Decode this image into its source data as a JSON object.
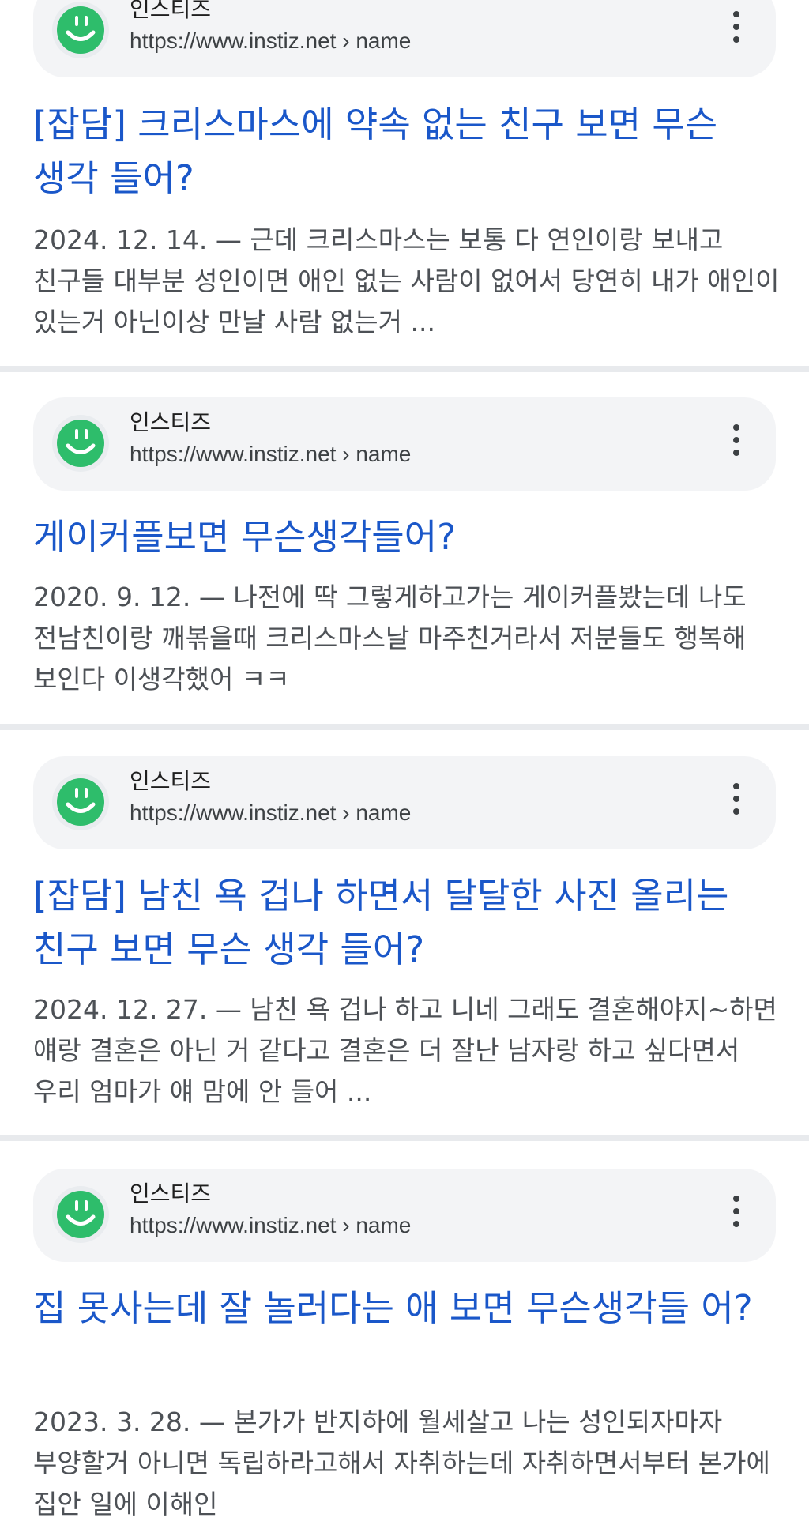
{
  "results": [
    {
      "site_name": "인스티즈",
      "url": "https://www.instiz.net › name",
      "title": "[잡담] 크리스마스에 약속 없는 친구 보면 무슨 생각 들어?",
      "date": "2024. 12. 14.",
      "snippet": "— 근데 크리스마스는 보통 다 연인이랑 보내고 친구들 대부분 성인이면 애인 없는 사람이 없어서 당연히 내가 애인이 있는거 아닌이상 만날 사람 없는거 ..."
    },
    {
      "site_name": "인스티즈",
      "url": "https://www.instiz.net › name",
      "title": "게이커플보면 무슨생각들어?",
      "date": "2020. 9. 12.",
      "snippet": "— 나전에 딱 그렇게하고가는 게이커플봤는데 나도 전남친이랑 깨볶을때 크리스마스날 마주친거라서 저분들도 행복해 보인다 이생각했어 ㅋㅋ"
    },
    {
      "site_name": "인스티즈",
      "url": "https://www.instiz.net › name",
      "title": "[잡담] 남친 욕 겁나 하면서 달달한 사진 올리는 친구 보면 무슨 생각 들어?",
      "date": "2024. 12. 27.",
      "snippet": "— 남친 욕 겁나 하고 니네 그래도 결혼해야지~하면 얘랑 결혼은 아닌 거 같다고 결혼은 더 잘난 남자랑 하고 싶다면서 우리 엄마가 얘 맘에 안 들어 ..."
    },
    {
      "site_name": "인스티즈",
      "url": "https://www.instiz.net › name",
      "title": "집 못사는데 잘 놀러다는 애 보면 무슨생각들 어?",
      "date": "2023. 3. 28.",
      "snippet": "— 본가가 반지하에 월세살고 나는 성인되자마자 부양할거 아니면 독립하라고해서 자취하는데 자취하면서부터 본가에 집안 일에 이해인"
    }
  ],
  "icons": {
    "favicon": "smiley-face-icon",
    "more": "more-vertical-icon"
  },
  "colors": {
    "title_link": "#1a57c9",
    "favicon_green": "#2ebd6b",
    "pill_bg": "#f3f4f6"
  }
}
